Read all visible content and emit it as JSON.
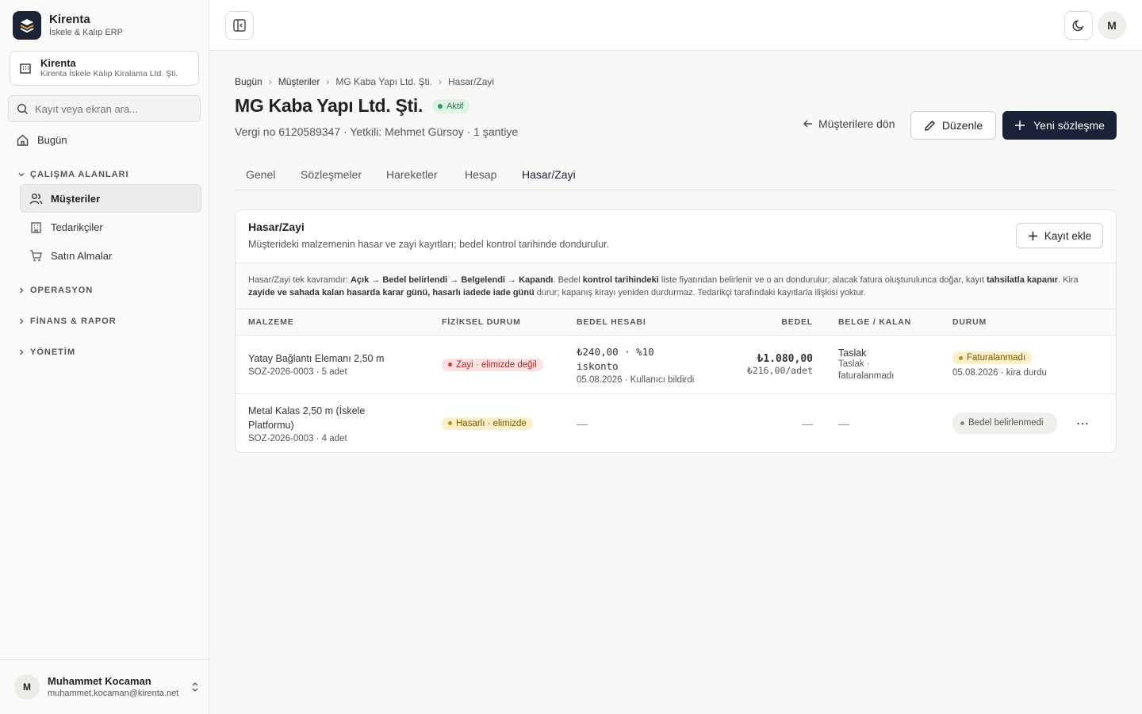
{
  "sidebar": {
    "brand_name": "Kirenta",
    "brand_sub": "İskele & Kalıp ERP",
    "org_name": "Kirenta",
    "org_sub": "Kirenta İskele Kalıp Kiralama Ltd. Şti.",
    "search_placeholder": "Kayıt veya ekran ara...",
    "today": "Bugün",
    "sections": {
      "work": "ÇALIŞMA ALANLARI",
      "ops": "OPERASYON",
      "finance": "FİNANS & RAPOR",
      "admin": "YÖNETİM"
    },
    "items": [
      "Müşteriler",
      "Tedarikçiler",
      "Satın Almalar"
    ],
    "user_initial": "M",
    "user_name": "Muhammet Kocaman",
    "user_email": "muhammet.kocaman@kirenta.net"
  },
  "topbar": {
    "avatar_initial": "M"
  },
  "breadcrumb": [
    "Bugün",
    "Müşteriler",
    "MG Kaba Yapı Ltd. Şti.",
    "Hasar/Zayi"
  ],
  "header": {
    "title": "MG Kaba Yapı Ltd. Şti.",
    "status": "Aktif",
    "subline": "Vergi no 6120589347 · Yetkili: Mehmet Gürsoy · 1 şantiye",
    "back": "Müşterilere dön",
    "edit": "Düzenle",
    "new_contract": "Yeni sözleşme"
  },
  "tabs": [
    "Genel",
    "Sözleşmeler",
    "Hareketler",
    "Hesap",
    "Hasar/Zayi"
  ],
  "card": {
    "title": "Hasar/Zayi",
    "subtitle": "Müşterideki malzemenin hasar ve zayi kayıtları; bedel kontrol tarihinde dondurulur.",
    "add": "Kayıt ekle",
    "info": {
      "p1": "Hasar/Zayi tek kavramdır: ",
      "b1": "Açık → Bedel belirlendi → Belgelendi → Kapandı",
      "p2": ". Bedel ",
      "b2": "kontrol tarihindeki",
      "p3": " liste fiyatından belirlenir ve o an dondurulur; alacak fatura oluşturulunca doğar, kayıt ",
      "b3": "tahsilatla kapanır",
      "p4": ". Kira ",
      "b4": "zayide ve sahada kalan hasarda karar günü, hasarlı iadede iade günü",
      "p5": " durur; kapanış kirayı yeniden durdurmaz. Tedarikçi tarafındaki kayıtlarla ilişkisi yoktur."
    },
    "columns": [
      "MALZEME",
      "FİZİKSEL DURUM",
      "BEDEL HESABI",
      "BEDEL",
      "BELGE / KALAN",
      "DURUM"
    ],
    "rows": [
      {
        "name": "Yatay Bağlantı Elemanı 2,50 m",
        "meta": "SOZ-2026-0003 · 5 adet",
        "physical": "Zayi · elimizde değil",
        "calc": "₺240,00 · %10 iskonto",
        "calc_meta": "05.08.2026 · Kullanıcı bildirdi",
        "amount": "₺1.080,00",
        "unit": "₺216,00/adet",
        "doc": "Taslak",
        "doc_meta": "Taslak · faturalanmadı",
        "status": "Faturalanmadı",
        "status_meta": "05.08.2026 · kira durdu"
      },
      {
        "name": "Metal Kalas 2,50 m (İskele Platformu)",
        "meta": "SOZ-2026-0003 · 4 adet",
        "physical": "Hasarlı · elimizde",
        "calc": "—",
        "amount": "—",
        "doc": "—",
        "status": "Bedel belirlenmedi"
      }
    ]
  }
}
